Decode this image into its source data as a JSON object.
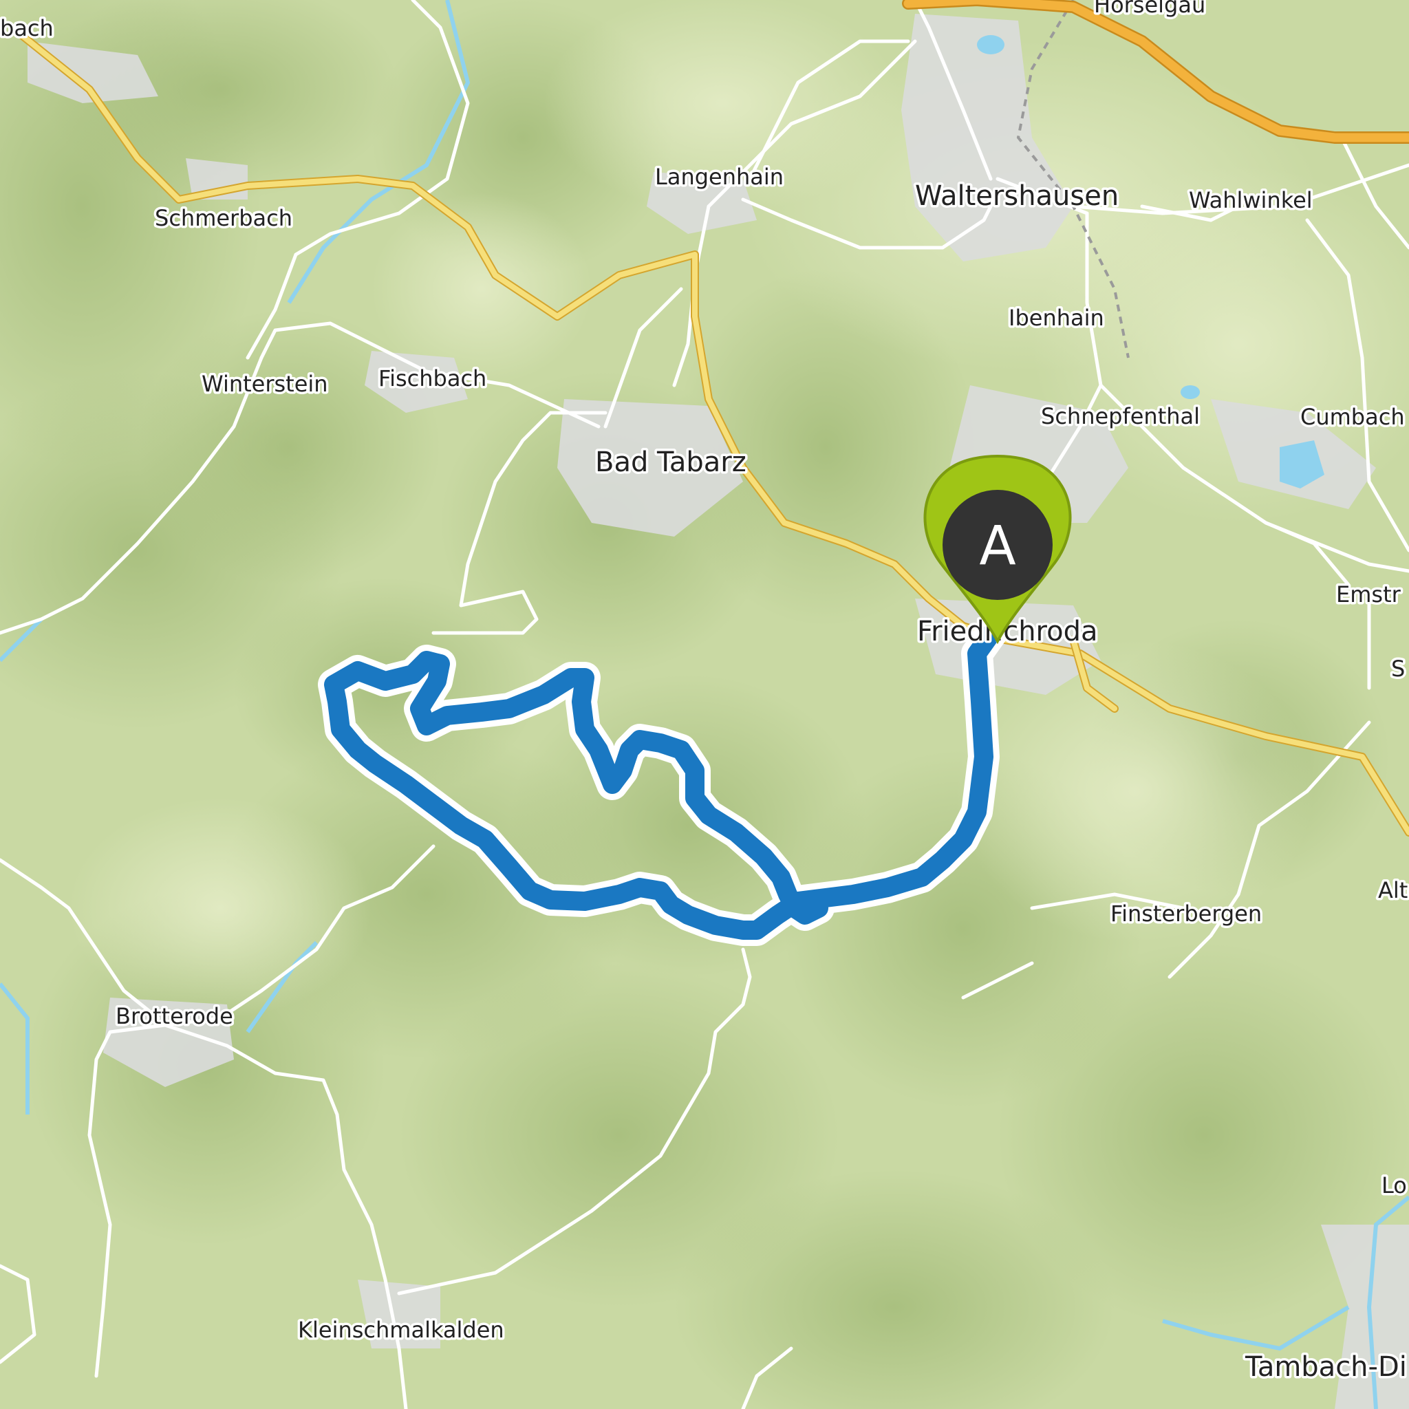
{
  "places": {
    "horselgau": "Hörselgau",
    "bach": "bach",
    "schmerbach": "Schmerbach",
    "langenhain": "Langenhain",
    "waltershausen": "Waltershausen",
    "wahlwinkel": "Wahlwinkel",
    "ibenhain": "Ibenhain",
    "winterstein": "Winterstein",
    "fischbach": "Fischbach",
    "bad_tabarz": "Bad Tabarz",
    "schnepfenthal": "Schnepfenthal",
    "cumbach": "Cumbach",
    "emstr": "Emstr",
    "friedrichroda": "Friedrichroda",
    "s": "S",
    "finsterbergen": "Finsterbergen",
    "alten": "Alten",
    "brotterode": "Brotterode",
    "lo": "Lo",
    "kleinschmalkalden": "Kleinschmalkalden",
    "tambach": "Tambach-Di"
  },
  "marker": {
    "letter": "A"
  },
  "colors": {
    "terrain": "#c9d9a3",
    "forest_shade": "#a7bf7e",
    "route": "#1a78c2",
    "highway": "#f3b23c",
    "main_road": "#f6df7a",
    "road": "#ffffff",
    "water": "#8fd2ee",
    "settlement": "#dadcdc",
    "marker_fill": "#9fc516",
    "marker_inner": "#333333"
  }
}
